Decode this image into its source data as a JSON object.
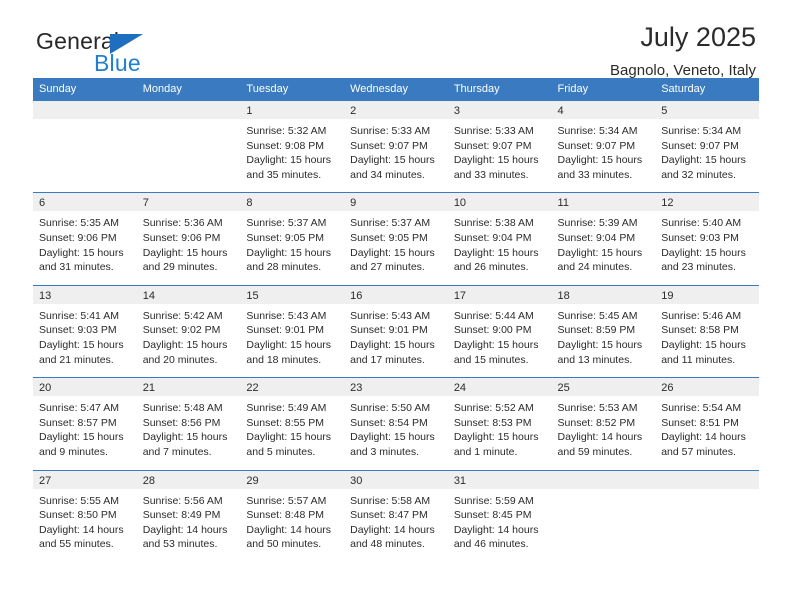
{
  "brand": {
    "name_top": "General",
    "name_bottom": "Blue",
    "triangle_color": "#1f6fc0",
    "text_color": "#1f7fd0"
  },
  "header": {
    "title": "July 2025",
    "subtitle": "Bagnolo, Veneto, Italy"
  },
  "theme": {
    "header_bg": "#3a7ac0",
    "header_text": "#ffffff",
    "daynum_bg": "#efefef",
    "body_text": "#2b2b2b"
  },
  "weekday_headers": [
    "Sunday",
    "Monday",
    "Tuesday",
    "Wednesday",
    "Thursday",
    "Friday",
    "Saturday"
  ],
  "weeks": [
    [
      {
        "day": "",
        "sunrise": "",
        "sunset": "",
        "daylight_1": "",
        "daylight_2": ""
      },
      {
        "day": "",
        "sunrise": "",
        "sunset": "",
        "daylight_1": "",
        "daylight_2": ""
      },
      {
        "day": "1",
        "sunrise": "Sunrise: 5:32 AM",
        "sunset": "Sunset: 9:08 PM",
        "daylight_1": "Daylight: 15 hours",
        "daylight_2": "and 35 minutes."
      },
      {
        "day": "2",
        "sunrise": "Sunrise: 5:33 AM",
        "sunset": "Sunset: 9:07 PM",
        "daylight_1": "Daylight: 15 hours",
        "daylight_2": "and 34 minutes."
      },
      {
        "day": "3",
        "sunrise": "Sunrise: 5:33 AM",
        "sunset": "Sunset: 9:07 PM",
        "daylight_1": "Daylight: 15 hours",
        "daylight_2": "and 33 minutes."
      },
      {
        "day": "4",
        "sunrise": "Sunrise: 5:34 AM",
        "sunset": "Sunset: 9:07 PM",
        "daylight_1": "Daylight: 15 hours",
        "daylight_2": "and 33 minutes."
      },
      {
        "day": "5",
        "sunrise": "Sunrise: 5:34 AM",
        "sunset": "Sunset: 9:07 PM",
        "daylight_1": "Daylight: 15 hours",
        "daylight_2": "and 32 minutes."
      }
    ],
    [
      {
        "day": "6",
        "sunrise": "Sunrise: 5:35 AM",
        "sunset": "Sunset: 9:06 PM",
        "daylight_1": "Daylight: 15 hours",
        "daylight_2": "and 31 minutes."
      },
      {
        "day": "7",
        "sunrise": "Sunrise: 5:36 AM",
        "sunset": "Sunset: 9:06 PM",
        "daylight_1": "Daylight: 15 hours",
        "daylight_2": "and 29 minutes."
      },
      {
        "day": "8",
        "sunrise": "Sunrise: 5:37 AM",
        "sunset": "Sunset: 9:05 PM",
        "daylight_1": "Daylight: 15 hours",
        "daylight_2": "and 28 minutes."
      },
      {
        "day": "9",
        "sunrise": "Sunrise: 5:37 AM",
        "sunset": "Sunset: 9:05 PM",
        "daylight_1": "Daylight: 15 hours",
        "daylight_2": "and 27 minutes."
      },
      {
        "day": "10",
        "sunrise": "Sunrise: 5:38 AM",
        "sunset": "Sunset: 9:04 PM",
        "daylight_1": "Daylight: 15 hours",
        "daylight_2": "and 26 minutes."
      },
      {
        "day": "11",
        "sunrise": "Sunrise: 5:39 AM",
        "sunset": "Sunset: 9:04 PM",
        "daylight_1": "Daylight: 15 hours",
        "daylight_2": "and 24 minutes."
      },
      {
        "day": "12",
        "sunrise": "Sunrise: 5:40 AM",
        "sunset": "Sunset: 9:03 PM",
        "daylight_1": "Daylight: 15 hours",
        "daylight_2": "and 23 minutes."
      }
    ],
    [
      {
        "day": "13",
        "sunrise": "Sunrise: 5:41 AM",
        "sunset": "Sunset: 9:03 PM",
        "daylight_1": "Daylight: 15 hours",
        "daylight_2": "and 21 minutes."
      },
      {
        "day": "14",
        "sunrise": "Sunrise: 5:42 AM",
        "sunset": "Sunset: 9:02 PM",
        "daylight_1": "Daylight: 15 hours",
        "daylight_2": "and 20 minutes."
      },
      {
        "day": "15",
        "sunrise": "Sunrise: 5:43 AM",
        "sunset": "Sunset: 9:01 PM",
        "daylight_1": "Daylight: 15 hours",
        "daylight_2": "and 18 minutes."
      },
      {
        "day": "16",
        "sunrise": "Sunrise: 5:43 AM",
        "sunset": "Sunset: 9:01 PM",
        "daylight_1": "Daylight: 15 hours",
        "daylight_2": "and 17 minutes."
      },
      {
        "day": "17",
        "sunrise": "Sunrise: 5:44 AM",
        "sunset": "Sunset: 9:00 PM",
        "daylight_1": "Daylight: 15 hours",
        "daylight_2": "and 15 minutes."
      },
      {
        "day": "18",
        "sunrise": "Sunrise: 5:45 AM",
        "sunset": "Sunset: 8:59 PM",
        "daylight_1": "Daylight: 15 hours",
        "daylight_2": "and 13 minutes."
      },
      {
        "day": "19",
        "sunrise": "Sunrise: 5:46 AM",
        "sunset": "Sunset: 8:58 PM",
        "daylight_1": "Daylight: 15 hours",
        "daylight_2": "and 11 minutes."
      }
    ],
    [
      {
        "day": "20",
        "sunrise": "Sunrise: 5:47 AM",
        "sunset": "Sunset: 8:57 PM",
        "daylight_1": "Daylight: 15 hours",
        "daylight_2": "and 9 minutes."
      },
      {
        "day": "21",
        "sunrise": "Sunrise: 5:48 AM",
        "sunset": "Sunset: 8:56 PM",
        "daylight_1": "Daylight: 15 hours",
        "daylight_2": "and 7 minutes."
      },
      {
        "day": "22",
        "sunrise": "Sunrise: 5:49 AM",
        "sunset": "Sunset: 8:55 PM",
        "daylight_1": "Daylight: 15 hours",
        "daylight_2": "and 5 minutes."
      },
      {
        "day": "23",
        "sunrise": "Sunrise: 5:50 AM",
        "sunset": "Sunset: 8:54 PM",
        "daylight_1": "Daylight: 15 hours",
        "daylight_2": "and 3 minutes."
      },
      {
        "day": "24",
        "sunrise": "Sunrise: 5:52 AM",
        "sunset": "Sunset: 8:53 PM",
        "daylight_1": "Daylight: 15 hours",
        "daylight_2": "and 1 minute."
      },
      {
        "day": "25",
        "sunrise": "Sunrise: 5:53 AM",
        "sunset": "Sunset: 8:52 PM",
        "daylight_1": "Daylight: 14 hours",
        "daylight_2": "and 59 minutes."
      },
      {
        "day": "26",
        "sunrise": "Sunrise: 5:54 AM",
        "sunset": "Sunset: 8:51 PM",
        "daylight_1": "Daylight: 14 hours",
        "daylight_2": "and 57 minutes."
      }
    ],
    [
      {
        "day": "27",
        "sunrise": "Sunrise: 5:55 AM",
        "sunset": "Sunset: 8:50 PM",
        "daylight_1": "Daylight: 14 hours",
        "daylight_2": "and 55 minutes."
      },
      {
        "day": "28",
        "sunrise": "Sunrise: 5:56 AM",
        "sunset": "Sunset: 8:49 PM",
        "daylight_1": "Daylight: 14 hours",
        "daylight_2": "and 53 minutes."
      },
      {
        "day": "29",
        "sunrise": "Sunrise: 5:57 AM",
        "sunset": "Sunset: 8:48 PM",
        "daylight_1": "Daylight: 14 hours",
        "daylight_2": "and 50 minutes."
      },
      {
        "day": "30",
        "sunrise": "Sunrise: 5:58 AM",
        "sunset": "Sunset: 8:47 PM",
        "daylight_1": "Daylight: 14 hours",
        "daylight_2": "and 48 minutes."
      },
      {
        "day": "31",
        "sunrise": "Sunrise: 5:59 AM",
        "sunset": "Sunset: 8:45 PM",
        "daylight_1": "Daylight: 14 hours",
        "daylight_2": "and 46 minutes."
      },
      {
        "day": "",
        "sunrise": "",
        "sunset": "",
        "daylight_1": "",
        "daylight_2": ""
      },
      {
        "day": "",
        "sunrise": "",
        "sunset": "",
        "daylight_1": "",
        "daylight_2": ""
      }
    ]
  ]
}
